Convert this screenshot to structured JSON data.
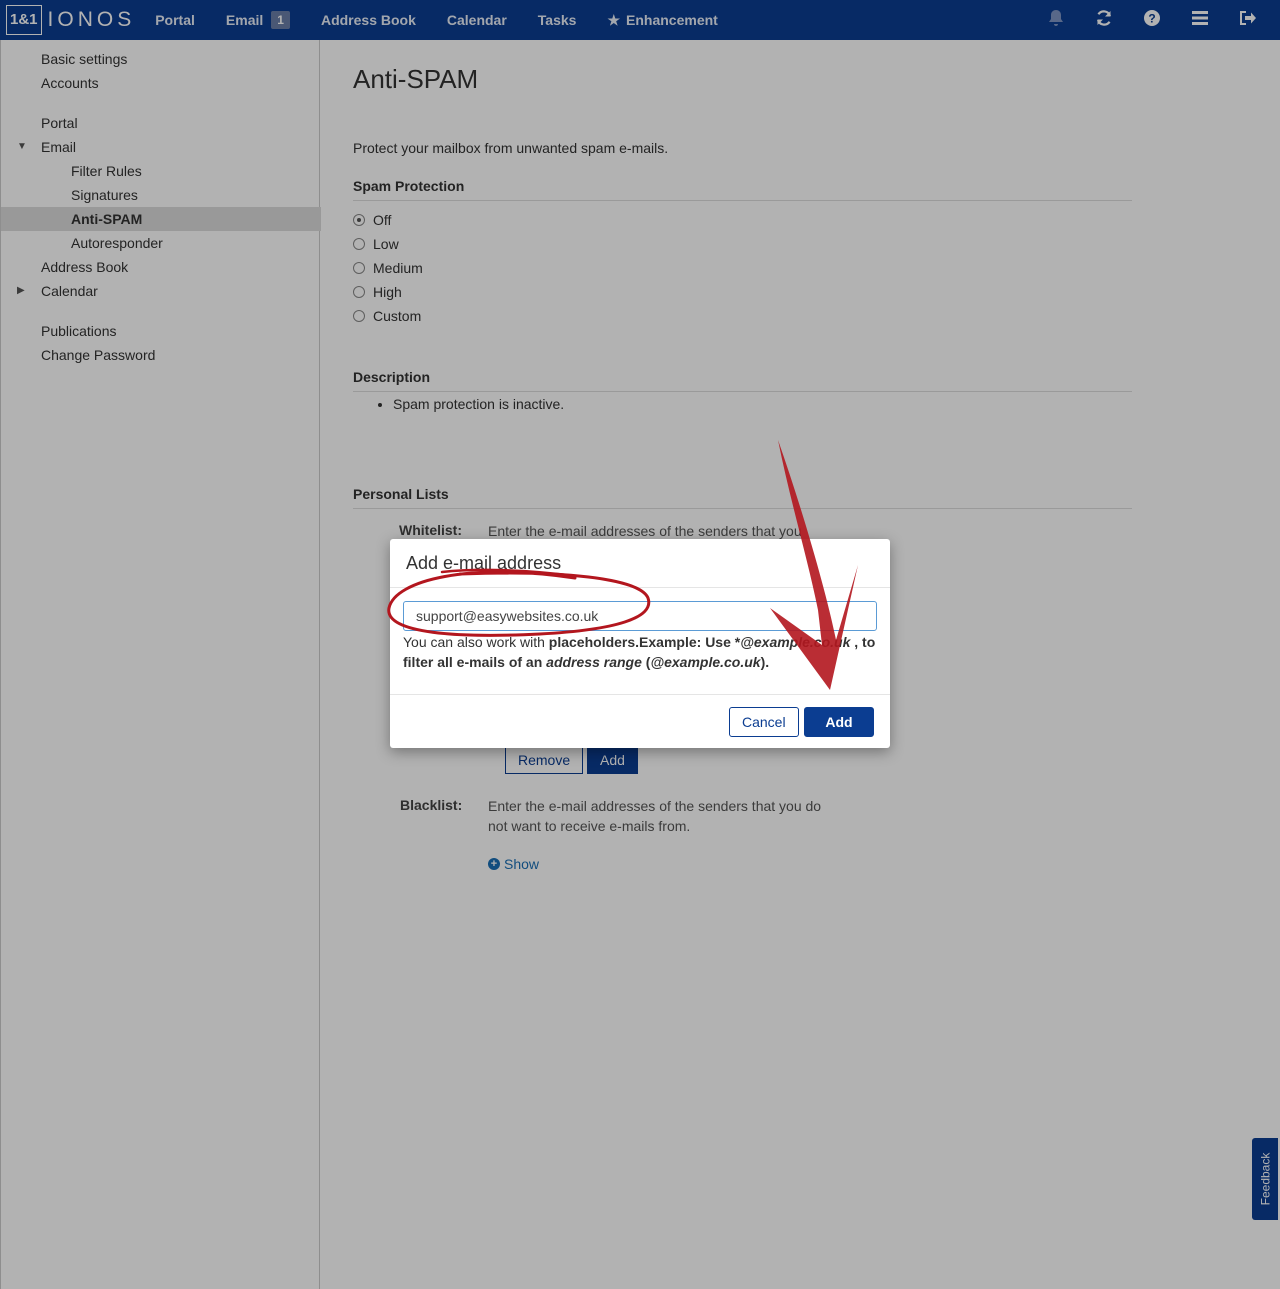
{
  "topbar": {
    "logo_box": "1&1",
    "logo_word": "IONOS",
    "nav": [
      {
        "label": "Portal"
      },
      {
        "label": "Email",
        "badge": "1"
      },
      {
        "label": "Address Book"
      },
      {
        "label": "Calendar"
      },
      {
        "label": "Tasks"
      },
      {
        "label": "Enhancement",
        "icon": "star-icon"
      }
    ],
    "right_icons": [
      "bell-icon",
      "refresh-icon",
      "help-icon",
      "menu-icon",
      "logout-icon"
    ]
  },
  "sidebar": {
    "items": [
      {
        "label": "Basic settings"
      },
      {
        "label": "Accounts"
      },
      {
        "label": "Portal"
      },
      {
        "label": "Email",
        "expanded": true
      },
      {
        "label": "Filter Rules"
      },
      {
        "label": "Signatures"
      },
      {
        "label": "Anti-SPAM",
        "active": true
      },
      {
        "label": "Autoresponder"
      },
      {
        "label": "Address Book"
      },
      {
        "label": "Calendar",
        "expanded": false
      },
      {
        "label": "Publications"
      },
      {
        "label": "Change Password"
      }
    ]
  },
  "main": {
    "title": "Anti-SPAM",
    "intro": "Protect your mailbox from unwanted spam e-mails.",
    "spam_protection": {
      "heading": "Spam Protection",
      "options": [
        "Off",
        "Low",
        "Medium",
        "High",
        "Custom"
      ],
      "selected": "Off"
    },
    "description": {
      "heading": "Description",
      "items": [
        "Spam protection is inactive."
      ]
    },
    "personal_lists": {
      "heading": "Personal Lists",
      "whitelist_label": "Whitelist:",
      "whitelist_text": "Enter the e-mail addresses of the senders that you",
      "remove_label": "Remove",
      "add_label": "Add",
      "blacklist_label": "Blacklist:",
      "blacklist_text": "Enter the e-mail addresses of the senders that you do not want to receive e-mails from.",
      "show_label": "Show"
    }
  },
  "modal": {
    "title": "Add e-mail address",
    "input_value": "support@easywebsites.co.uk",
    "help": {
      "prefix": "You can also work with ",
      "bold1": "placeholders.Example: Use *",
      "italic1": "@example.co.uk",
      "bold2": " , to filter all e-mails of an ",
      "italic2": "address range",
      "bold3": " (",
      "italic3": "@example.co.uk",
      "bold4": ")."
    },
    "cancel_label": "Cancel",
    "add_label": "Add"
  },
  "feedback_label": "Feedback",
  "colors": {
    "brand": "#0b3d91",
    "annotation_red": "#b3161e",
    "link": "#1a6fb5"
  }
}
